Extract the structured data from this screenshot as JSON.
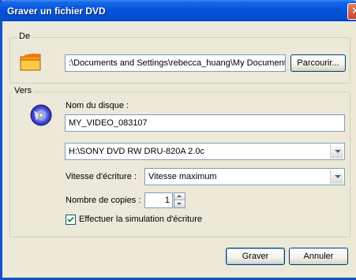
{
  "window": {
    "title": "Graver un fichier DVD",
    "close_symbol": "✕"
  },
  "source": {
    "group_label": "De",
    "path": ":\\Documents and Settings\\rebecca_huang\\My Documents\\",
    "browse_label": "Parcourir..."
  },
  "target": {
    "group_label": "Vers",
    "disc_name_label": "Nom du disque :",
    "disc_name_value": "MY_VIDEO_083107",
    "drive_selected": "H:\\SONY DVD RW DRU-820A 2.0c",
    "speed_label": "Vitesse d'écriture :",
    "speed_selected": "Vitesse maximum",
    "copies_label": "Nombre de copies :",
    "copies_value": "1",
    "simulate_label": "Effectuer la simulation d'écriture",
    "simulate_checked": true
  },
  "actions": {
    "ok_label": "Graver",
    "cancel_label": "Annuler"
  },
  "icons": {
    "source": "folder-icon",
    "target": "dvd-disc-icon"
  }
}
